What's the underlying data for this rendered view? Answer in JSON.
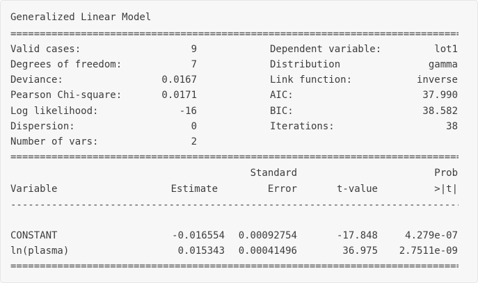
{
  "title": "Generalized Linear Model",
  "separator_double": "=====================================================================================================",
  "separator_single": "-----------------------------------------------------------------------------------------------------",
  "summary_left": [
    {
      "label": "Valid cases:",
      "value": "9"
    },
    {
      "label": "Degrees of freedom:",
      "value": "7"
    },
    {
      "label": "Deviance:",
      "value": "0.0167"
    },
    {
      "label": "Pearson Chi-square:",
      "value": "0.0171"
    },
    {
      "label": "Log likelihood:",
      "value": "-16"
    },
    {
      "label": "Dispersion:",
      "value": "0"
    },
    {
      "label": "Number of vars:",
      "value": "2"
    }
  ],
  "summary_right": [
    {
      "label": "Dependent variable:",
      "value": "lot1"
    },
    {
      "label": "Distribution",
      "value": "gamma"
    },
    {
      "label": "Link function:",
      "value": "inverse"
    },
    {
      "label": "AIC:",
      "value": "37.990"
    },
    {
      "label": "BIC:",
      "value": "38.582"
    },
    {
      "label": "Iterations:",
      "value": "38"
    }
  ],
  "table": {
    "header_top": {
      "std_error": "Standard",
      "prob": "Prob"
    },
    "header_bottom": {
      "variable": "Variable",
      "estimate": "Estimate",
      "std_error": "Error",
      "t_value": "t-value",
      "prob": ">|t|"
    },
    "rows": [
      {
        "variable": "CONSTANT",
        "estimate": "-0.016554",
        "std_error": "0.00092754",
        "t_value": "-17.848",
        "prob": "4.279e-07"
      },
      {
        "variable": "ln(plasma)",
        "estimate": "0.015343",
        "std_error": "0.00041496",
        "t_value": "36.975",
        "prob": "2.7511e-09"
      }
    ]
  }
}
